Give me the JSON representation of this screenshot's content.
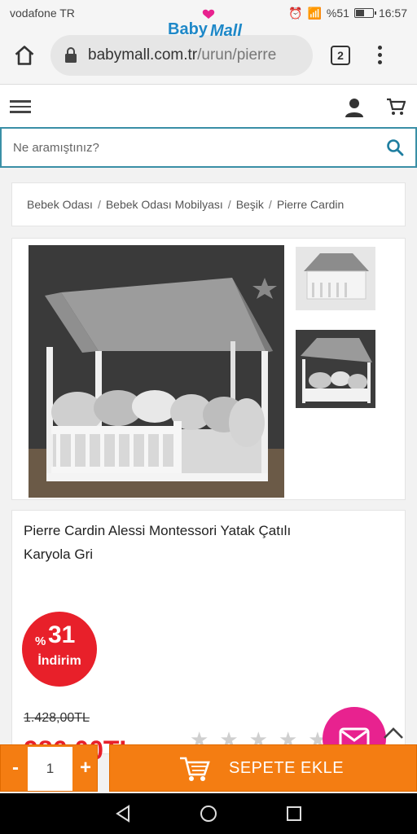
{
  "status_bar": {
    "carrier": "vodafone TR",
    "battery": "%51",
    "time": "16:57",
    "battery_level": 0.51
  },
  "browser": {
    "domain": "babymall.com.tr",
    "path": "/urun/pierre",
    "tab_count": "2"
  },
  "site": {
    "logo_text": "Baby Mall",
    "search_placeholder": "Ne aramıştınız?"
  },
  "breadcrumb": [
    "Bebek Odası",
    "Bebek Odası Mobilyası",
    "Beşik",
    "Pierre Cardin"
  ],
  "product": {
    "title": "Pierre Cardin Alessi Montessori Yatak Çatılı Karyola Gri",
    "discount_symbol": "%",
    "discount_value": "31",
    "discount_label": "İndirim",
    "old_price": "1.428,00TL",
    "new_price": "986,00TL",
    "rating_max": 5
  },
  "cart": {
    "quantity": "1",
    "minus": "-",
    "plus": "+",
    "add_label": "SEPETE EKLE"
  },
  "colors": {
    "accent": "#f47d12",
    "discount": "#e8202a",
    "chat": "#e8228f",
    "search_border": "#3a8fa6"
  }
}
